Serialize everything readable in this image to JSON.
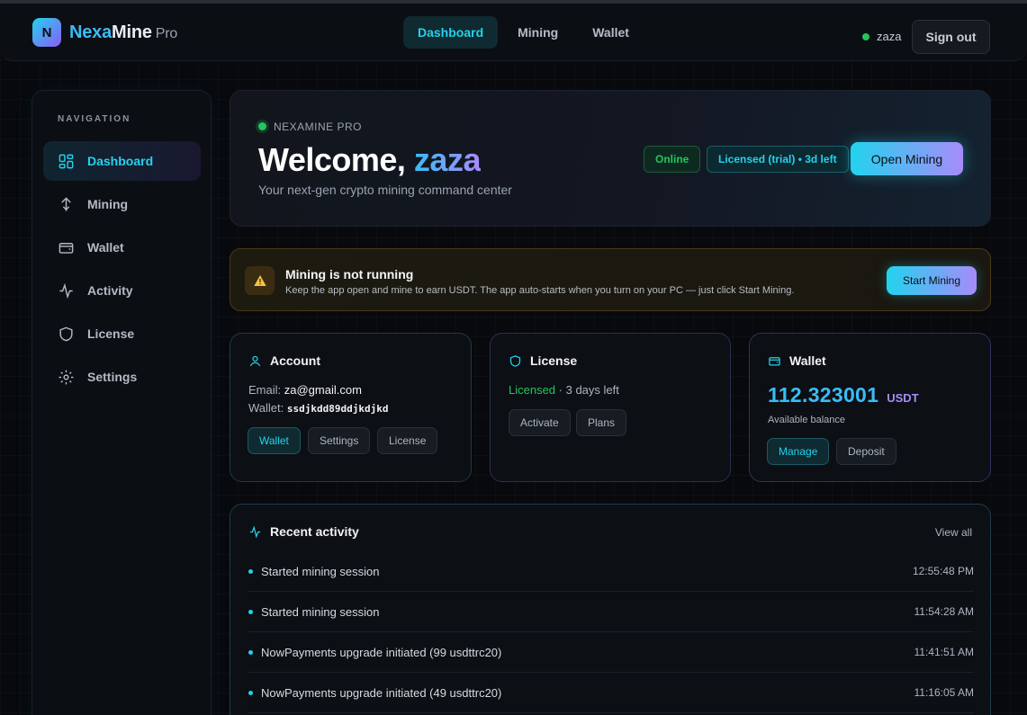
{
  "topbar": {
    "logo_letter": "N",
    "brand_part1": "Nexa",
    "brand_part2": "Mine",
    "brand_suffix": "Pro",
    "nav": [
      "Dashboard",
      "Mining",
      "Wallet"
    ],
    "active_nav": "Dashboard",
    "username": "zaza",
    "signout_label": "Sign out"
  },
  "sidebar": {
    "title": "NAVIGATION",
    "items": [
      {
        "label": "Dashboard",
        "icon": "grid-icon",
        "active": true
      },
      {
        "label": "Mining",
        "icon": "pickaxe-icon"
      },
      {
        "label": "Wallet",
        "icon": "wallet-icon"
      },
      {
        "label": "Activity",
        "icon": "activity-icon"
      },
      {
        "label": "License",
        "icon": "shield-icon"
      },
      {
        "label": "Settings",
        "icon": "gear-icon"
      }
    ]
  },
  "hero": {
    "kicker": "NEXAMINE PRO",
    "welcome": "Welcome,",
    "username": "zaza",
    "subtitle": "Your next-gen crypto mining command center",
    "status_pill": "Online",
    "license_pill": "Licensed (trial) • 3d left",
    "open_mining_label": "Open Mining"
  },
  "alert": {
    "title": "Mining is not running",
    "text": "Keep the app open and mine to earn USDT. The app auto-starts when you turn on your PC — just click Start Mining.",
    "button_label": "Start Mining"
  },
  "account": {
    "title": "Account",
    "email_label": "Email:",
    "email": "za@gmail.com",
    "wallet_label": "Wallet:",
    "wallet": "ssdjkdd89ddjkdjkd",
    "buttons": [
      "Wallet",
      "Settings",
      "License"
    ]
  },
  "license": {
    "title": "License",
    "status": "Licensed",
    "remaining": " · 3 days left",
    "buttons": [
      "Activate",
      "Plans"
    ]
  },
  "wallet": {
    "title": "Wallet",
    "balance": "112.323001",
    "unit": "USDT",
    "balance_label": "Available balance",
    "buttons": [
      "Manage",
      "Deposit"
    ]
  },
  "activity": {
    "title": "Recent activity",
    "view_all": "View all",
    "items": [
      {
        "desc": "Started mining session",
        "time": "12:55:48 PM"
      },
      {
        "desc": "Started mining session",
        "time": "11:54:28 AM"
      },
      {
        "desc": "NowPayments upgrade initiated (99 usdttrc20)",
        "time": "11:41:51 AM"
      },
      {
        "desc": "NowPayments upgrade initiated (49 usdttrc20)",
        "time": "11:16:05 AM"
      }
    ]
  },
  "colors": {
    "accent": "#22d3ee",
    "accent2": "#a78bfa",
    "success": "#22c55e",
    "warning": "#f5c242",
    "background": "#07090d"
  }
}
